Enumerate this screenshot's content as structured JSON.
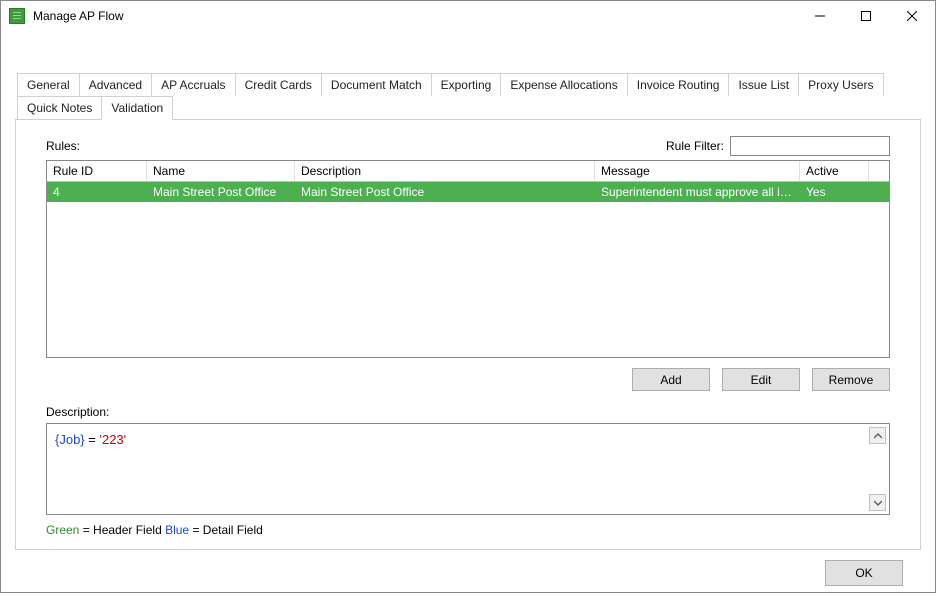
{
  "window": {
    "title": "Manage AP Flow"
  },
  "tabs": [
    "General",
    "Advanced",
    "AP Accruals",
    "Credit Cards",
    "Document Match",
    "Exporting",
    "Expense Allocations",
    "Invoice Routing",
    "Issue List",
    "Proxy Users",
    "Quick Notes",
    "Validation"
  ],
  "active_tab": "Validation",
  "labels": {
    "rules": "Rules:",
    "rule_filter": "Rule Filter:",
    "description": "Description:"
  },
  "rule_filter_value": "",
  "grid": {
    "columns": [
      "Rule ID",
      "Name",
      "Description",
      "Message",
      "Active"
    ],
    "rows": [
      {
        "rule_id": "4",
        "name": "Main Street Post Office",
        "description": "Main Street Post Office",
        "message": "Superintendent must approve all invoic...",
        "active": "Yes",
        "selected": true
      }
    ]
  },
  "buttons": {
    "add": "Add",
    "edit": "Edit",
    "remove": "Remove",
    "ok": "OK"
  },
  "description_expr": {
    "field": "{Job}",
    "op": " = ",
    "value": "'223'"
  },
  "legend": {
    "green_label": "Green",
    "green_text": "  = Header Field    ",
    "blue_label": "Blue",
    "blue_text": "  = Detail Field"
  }
}
